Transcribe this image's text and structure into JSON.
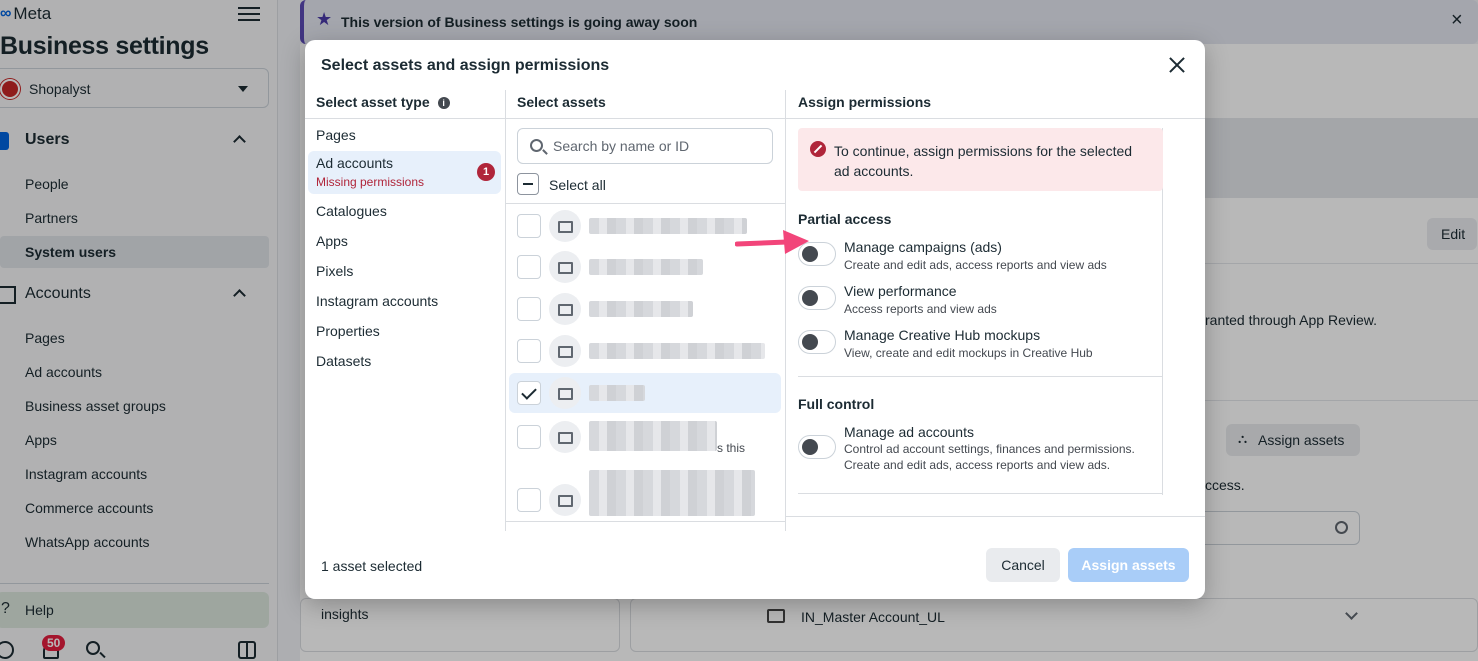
{
  "app": {
    "logo_text": "Meta",
    "title": "Business settings"
  },
  "business": {
    "name": "Shopalyst"
  },
  "sidebar": {
    "users_section": "Users",
    "users_items": [
      "People",
      "Partners",
      "System users"
    ],
    "accounts_section": "Accounts",
    "accounts_items": [
      "Pages",
      "Ad accounts",
      "Business asset groups",
      "Apps",
      "Instagram accounts",
      "Commerce accounts",
      "WhatsApp accounts"
    ],
    "help": "Help",
    "notifications_count": "50"
  },
  "background": {
    "banner": "This version of Business settings is going away soon",
    "edit_label": "Edit",
    "app_review_text": "ranted through App Review.",
    "assign_assets_label": "Assign assets",
    "access_text": "ccess.",
    "insights_label": "insights",
    "ad_account_name": "IN_Master Account_UL"
  },
  "modal": {
    "title": "Select assets and assign permissions",
    "asset_type_header": "Select asset type",
    "assets_header": "Select assets",
    "permissions_header": "Assign permissions",
    "asset_types": [
      "Pages",
      "Ad accounts",
      "Catalogues",
      "Apps",
      "Pixels",
      "Instagram accounts",
      "Properties",
      "Datasets"
    ],
    "ad_accounts_status": "Missing permissions",
    "ad_accounts_badge": "1",
    "search_placeholder": "Search by name or ID",
    "select_all": "Select all",
    "asset_row_trail": "s this",
    "error_message": "To continue, assign permissions for the selected ad accounts.",
    "partial_access": {
      "title": "Partial access",
      "permissions": [
        {
          "name": "Manage campaigns (ads)",
          "desc": "Create and edit ads, access reports and view ads"
        },
        {
          "name": "View performance",
          "desc": "Access reports and view ads"
        },
        {
          "name": "Manage Creative Hub mockups",
          "desc": "View, create and edit mockups in Creative Hub"
        }
      ]
    },
    "full_control": {
      "title": "Full control",
      "permissions": [
        {
          "name": "Manage ad accounts",
          "desc": "Control ad account settings, finances and permissions. Create and edit ads, access reports and view ads."
        }
      ]
    },
    "selected_count": "1 asset selected",
    "cancel_label": "Cancel",
    "assign_label": "Assign assets"
  }
}
